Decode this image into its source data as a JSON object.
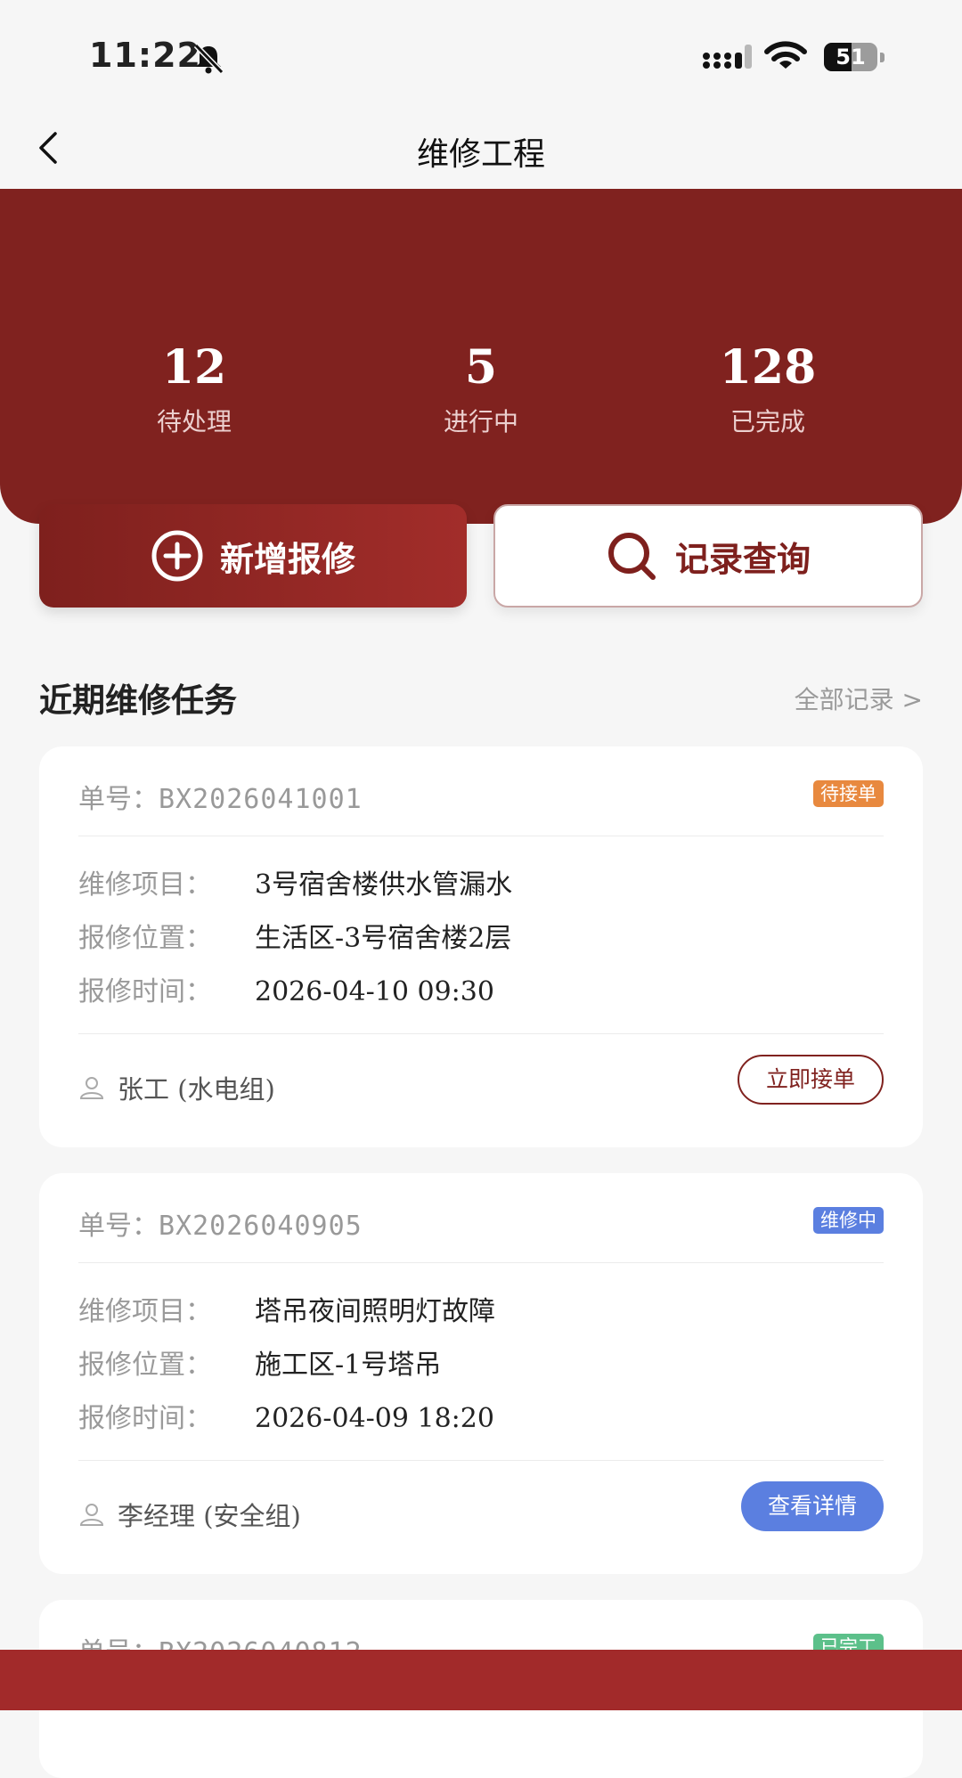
{
  "status_bar": {
    "time": "11:22",
    "battery": "51",
    "battery_level": 0.51
  },
  "header": {
    "title": "维修工程"
  },
  "stats": [
    {
      "value": "12",
      "label": "待处理"
    },
    {
      "value": "5",
      "label": "进行中"
    },
    {
      "value": "128",
      "label": "已完成"
    }
  ],
  "actions": {
    "add_label": "新增报修",
    "query_label": "记录查询"
  },
  "section": {
    "title": "近期维修任务",
    "link": "全部记录 >"
  },
  "tasks": [
    {
      "order_label": "单号：",
      "order_no": "BX2026041001",
      "status": "待接单",
      "status_color": "#e8893f",
      "item_label": "维修项目：",
      "item": "3号宿舍楼供水管漏水",
      "location_label": "报修位置：",
      "location": "生活区-3号宿舍楼2层",
      "time_label": "报修时间：",
      "time": "2026-04-10 09:30",
      "person": "张工 (水电组)",
      "action": "立即接单"
    },
    {
      "order_label": "单号：",
      "order_no": "BX2026040905",
      "status": "维修中",
      "status_color": "#5b7fe0",
      "item_label": "维修项目：",
      "item": "塔吊夜间照明灯故障",
      "location_label": "报修位置：",
      "location": "施工区-1号塔吊",
      "time_label": "报修时间：",
      "time": "2026-04-09 18:20",
      "person": "李经理 (安全组)",
      "action": "查看详情"
    },
    {
      "order_label": "单号：",
      "order_no": "BX2026040812",
      "status": "已完工",
      "status_color": "#5cc08a"
    }
  ],
  "colors": {
    "brand": "#80221f",
    "accent": "#a22d2a",
    "info": "#5b7fe0",
    "warning": "#e8893f",
    "success": "#5cc08a"
  }
}
